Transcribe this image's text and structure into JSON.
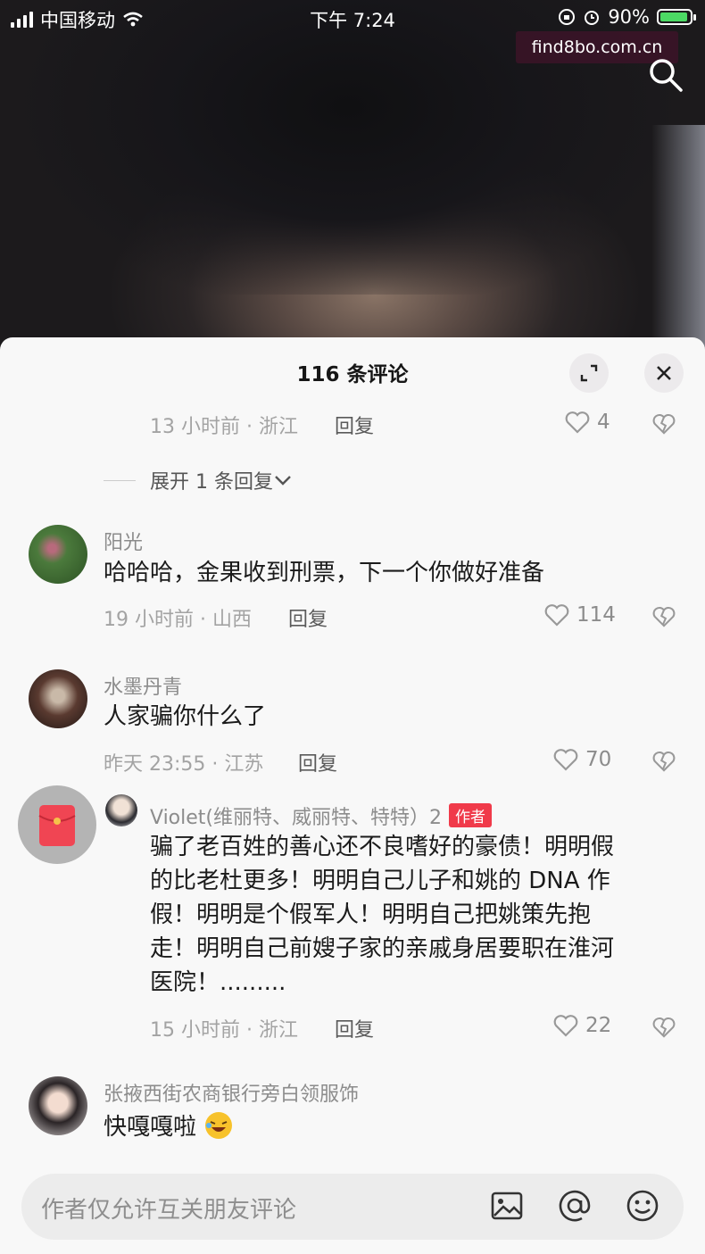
{
  "status_bar": {
    "carrier": "中国移动",
    "time": "下午 7:24",
    "battery": "90%"
  },
  "watermark": "find8bo.com.cn",
  "comments_panel": {
    "title": "116 条评论",
    "top_partial": {
      "meta": "13 小时前 · 浙江",
      "reply": "回复",
      "likes": "4"
    },
    "expand_replies": "展开 1 条回复",
    "comments": [
      {
        "user": "阳光",
        "text": "哈哈哈，金果收到刑票，下一个你做好准备",
        "meta": "19 小时前 · 山西",
        "reply": "回复",
        "likes": "114"
      },
      {
        "user": "水墨丹青",
        "text": "人家骗你什么了",
        "meta": "昨天 23:55 · 江苏",
        "reply": "回复",
        "likes": "70"
      },
      {
        "user": "Violet(维丽特、威丽特、特特）2",
        "badge": "作者",
        "lines": [
          "骗了老百姓的善心还不良嗜好的豪债！明明假",
          "的比老杜更多！明明自己儿子和姚的 DNA 作",
          "假！明明是个假军人！明明自己把姚策先抱",
          "走！明明自己前嫂子家的亲戚身居要职在淮河",
          "医院！........."
        ],
        "meta": "15 小时前 · 浙江",
        "reply": "回复",
        "likes": "22"
      },
      {
        "user": "张掖西街农商银行旁白领服饰",
        "text": "快嘎嘎啦"
      }
    ],
    "input_placeholder": "作者仅允许互关朋友评论"
  },
  "icons": [
    "search-icon",
    "expand-icon",
    "close-icon",
    "heart-icon",
    "broken-heart-icon",
    "chevron-down-icon",
    "red-envelope-icon",
    "image-icon",
    "at-icon",
    "emoji-icon",
    "laughing-emoji-icon"
  ]
}
